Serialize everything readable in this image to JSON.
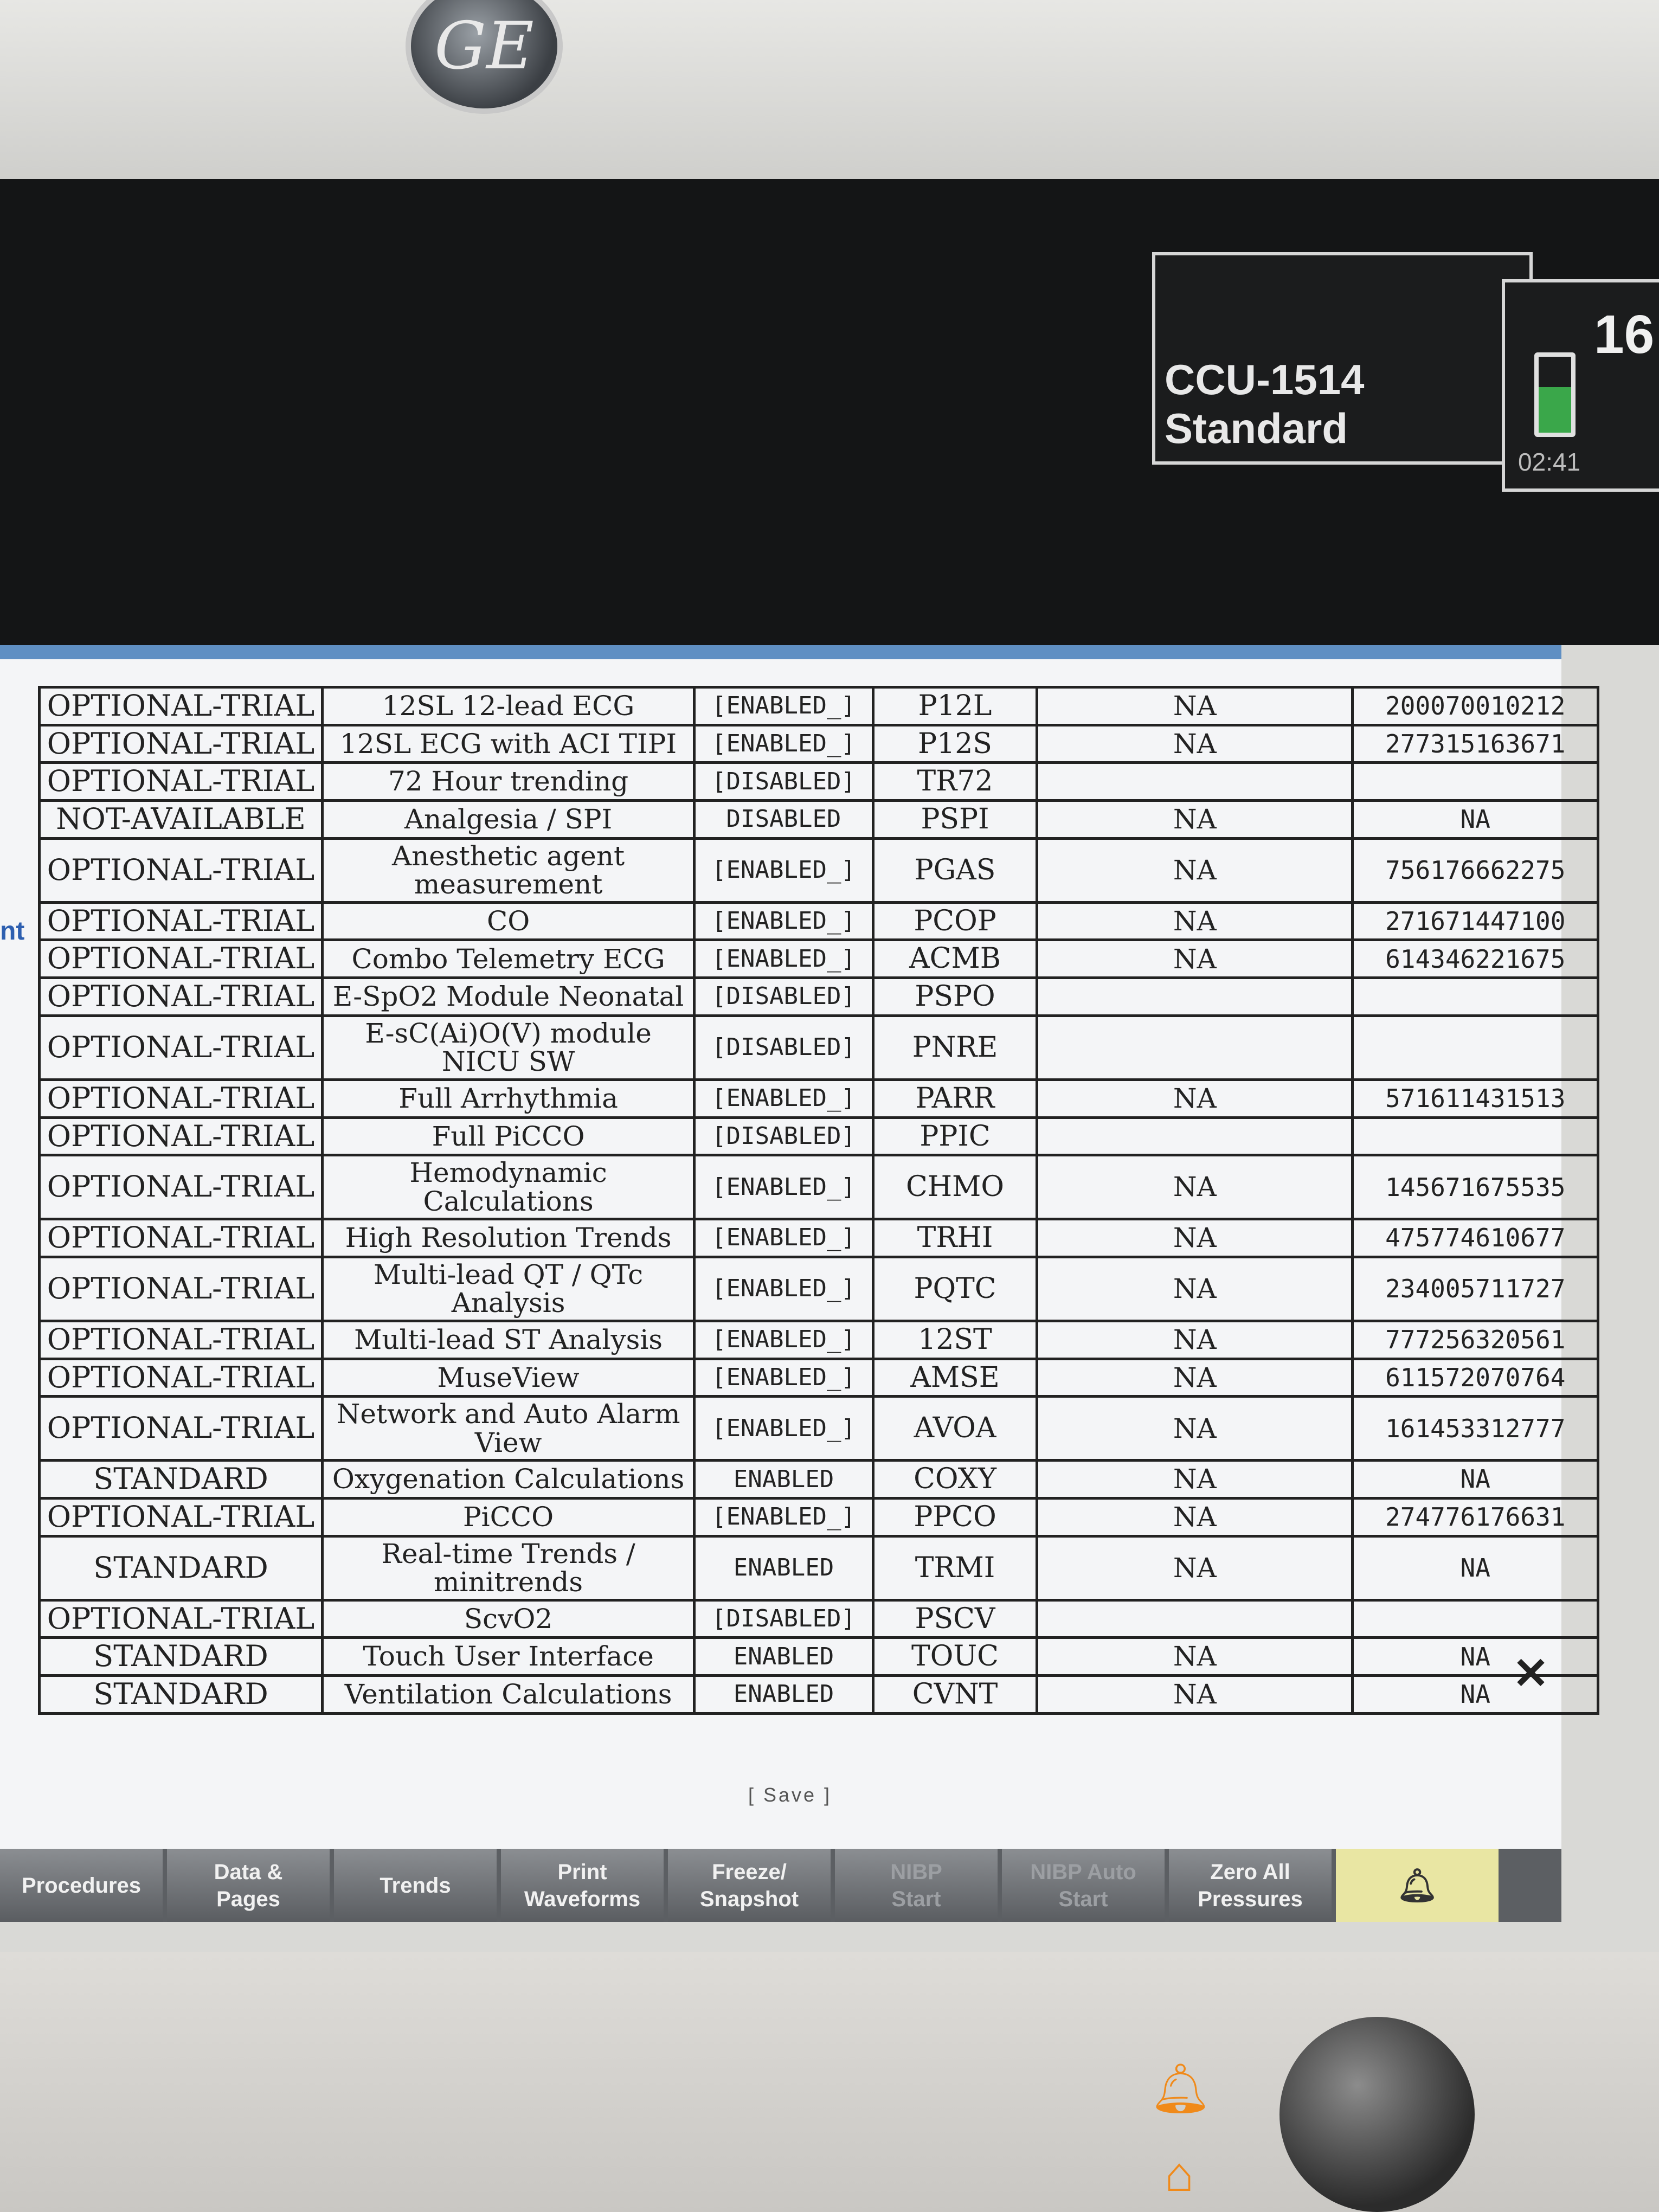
{
  "header": {
    "logo": "GE",
    "unit": "CCU-1514",
    "profile": "Standard",
    "battery_time": "02:41",
    "clock": "16:"
  },
  "left_edge_text": "nt",
  "table": {
    "rows": [
      [
        "OPTIONAL-TRIAL",
        "12SL 12-lead ECG",
        "[ENABLED_]",
        "P12L",
        "NA",
        "200070010212"
      ],
      [
        "OPTIONAL-TRIAL",
        "12SL ECG with ACI TIPI",
        "[ENABLED_]",
        "P12S",
        "NA",
        "277315163671"
      ],
      [
        "OPTIONAL-TRIAL",
        "72 Hour trending",
        "[DISABLED]",
        "TR72",
        "",
        ""
      ],
      [
        "NOT-AVAILABLE",
        "Analgesia / SPI",
        "DISABLED",
        "PSPI",
        "NA",
        "NA"
      ],
      [
        "OPTIONAL-TRIAL",
        "Anesthetic agent measurement",
        "[ENABLED_]",
        "PGAS",
        "NA",
        "756176662275"
      ],
      [
        "OPTIONAL-TRIAL",
        "CO",
        "[ENABLED_]",
        "PCOP",
        "NA",
        "271671447100"
      ],
      [
        "OPTIONAL-TRIAL",
        "Combo Telemetry ECG",
        "[ENABLED_]",
        "ACMB",
        "NA",
        "614346221675"
      ],
      [
        "OPTIONAL-TRIAL",
        "E-SpO2 Module Neonatal",
        "[DISABLED]",
        "PSPO",
        "",
        ""
      ],
      [
        "OPTIONAL-TRIAL",
        "E-sC(Ai)O(V) module NICU SW",
        "[DISABLED]",
        "PNRE",
        "",
        ""
      ],
      [
        "OPTIONAL-TRIAL",
        "Full Arrhythmia",
        "[ENABLED_]",
        "PARR",
        "NA",
        "571611431513"
      ],
      [
        "OPTIONAL-TRIAL",
        "Full PiCCO",
        "[DISABLED]",
        "PPIC",
        "",
        ""
      ],
      [
        "OPTIONAL-TRIAL",
        "Hemodynamic Calculations",
        "[ENABLED_]",
        "CHMO",
        "NA",
        "145671675535"
      ],
      [
        "OPTIONAL-TRIAL",
        "High Resolution Trends",
        "[ENABLED_]",
        "TRHI",
        "NA",
        "475774610677"
      ],
      [
        "OPTIONAL-TRIAL",
        "Multi-lead QT / QTc Analysis",
        "[ENABLED_]",
        "PQTC",
        "NA",
        "234005711727"
      ],
      [
        "OPTIONAL-TRIAL",
        "Multi-lead ST Analysis",
        "[ENABLED_]",
        "12ST",
        "NA",
        "777256320561"
      ],
      [
        "OPTIONAL-TRIAL",
        "MuseView",
        "[ENABLED_]",
        "AMSE",
        "NA",
        "611572070764"
      ],
      [
        "OPTIONAL-TRIAL",
        "Network and Auto Alarm View",
        "[ENABLED_]",
        "AVOA",
        "NA",
        "161453312777"
      ],
      [
        "STANDARD",
        "Oxygenation Calculations",
        "ENABLED",
        "COXY",
        "NA",
        "NA"
      ],
      [
        "OPTIONAL-TRIAL",
        "PiCCO",
        "[ENABLED_]",
        "PPCO",
        "NA",
        "274776176631"
      ],
      [
        "STANDARD",
        "Real-time Trends / minitrends",
        "ENABLED",
        "TRMI",
        "NA",
        "NA"
      ],
      [
        "OPTIONAL-TRIAL",
        "ScvO2",
        "[DISABLED]",
        "PSCV",
        "",
        ""
      ],
      [
        "STANDARD",
        "Touch User Interface",
        "ENABLED",
        "TOUC",
        "NA",
        "NA"
      ],
      [
        "STANDARD",
        "Ventilation Calculations",
        "ENABLED",
        "CVNT",
        "NA",
        "NA"
      ]
    ]
  },
  "save_label": "[ Save ]",
  "toolbar": {
    "buttons": [
      {
        "line1": "Procedures",
        "line2": ""
      },
      {
        "line1": "Data &",
        "line2": "Pages"
      },
      {
        "line1": "Trends",
        "line2": ""
      },
      {
        "line1": "Print",
        "line2": "Waveforms"
      },
      {
        "line1": "Freeze/",
        "line2": "Snapshot"
      },
      {
        "line1": "NIBP",
        "line2": "Start"
      },
      {
        "line1": "NIBP Auto",
        "line2": "Start"
      },
      {
        "line1": "Zero All",
        "line2": "Pressures"
      }
    ]
  },
  "icons": {
    "alarm_bell": "bell-icon",
    "home": "home-icon",
    "close": "close-icon"
  },
  "colors": {
    "panel_header": "#5f8fc3",
    "alarm_button": "#e9e6a3",
    "battery": "#3aa74a"
  }
}
